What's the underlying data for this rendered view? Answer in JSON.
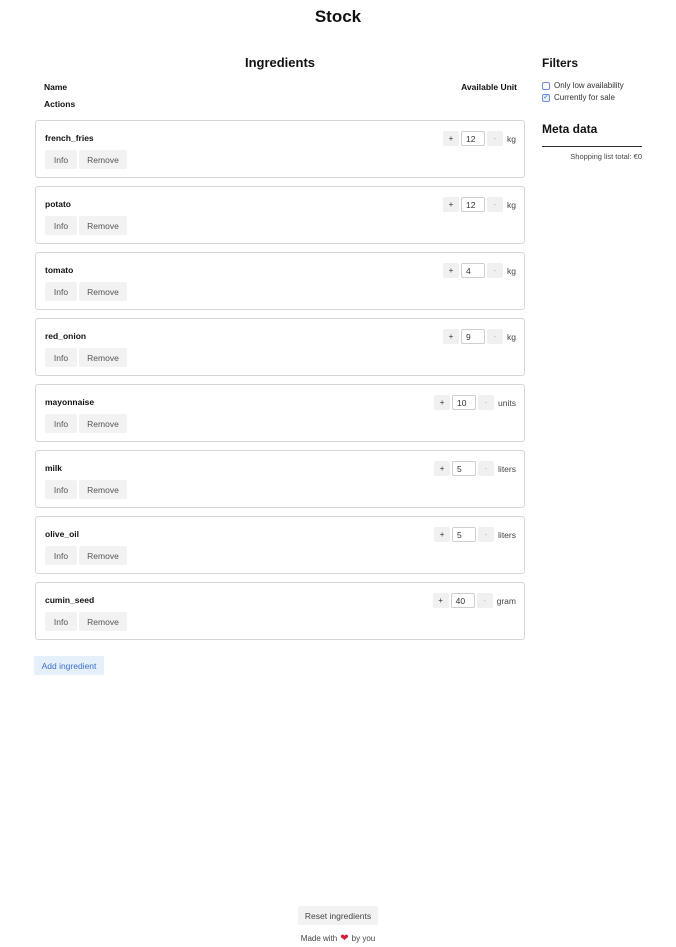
{
  "page": {
    "title": "Stock"
  },
  "ingredients": {
    "title": "Ingredients",
    "columns": {
      "name": "Name",
      "actions": "Actions",
      "available_unit": "Available Unit"
    },
    "info_label": "Info",
    "remove_label": "Remove",
    "plus_label": "+",
    "minus_label": "-",
    "items": [
      {
        "name": "french_fries",
        "qty": "12",
        "unit": "kg"
      },
      {
        "name": "potato",
        "qty": "12",
        "unit": "kg"
      },
      {
        "name": "tomato",
        "qty": "4",
        "unit": "kg"
      },
      {
        "name": "red_onion",
        "qty": "9",
        "unit": "kg"
      },
      {
        "name": "mayonnaise",
        "qty": "10",
        "unit": "units"
      },
      {
        "name": "milk",
        "qty": "5",
        "unit": "liters"
      },
      {
        "name": "olive_oil",
        "qty": "5",
        "unit": "liters"
      },
      {
        "name": "cumin_seed",
        "qty": "40",
        "unit": "gram"
      }
    ],
    "add_label": "Add ingredient"
  },
  "filters": {
    "title": "Filters",
    "options": [
      {
        "label": "Only low availability",
        "checked": false
      },
      {
        "label": "Currently for sale",
        "checked": true
      }
    ]
  },
  "meta": {
    "title": "Meta data",
    "shopping_total": "Shopping list total: €0"
  },
  "footer": {
    "reset_label": "Reset ingredients",
    "made_with": "Made with",
    "by": "by you"
  },
  "colors": {
    "accent": "#3b6fc9",
    "heart": "#d21f3c",
    "card_border": "#d6d6d6"
  }
}
